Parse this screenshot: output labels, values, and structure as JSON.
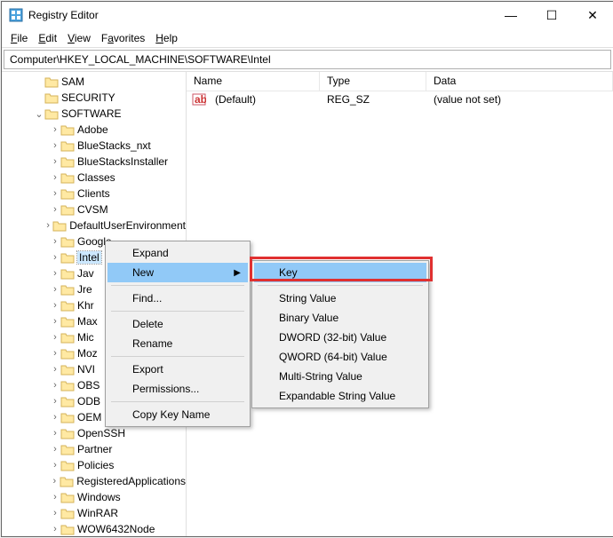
{
  "title": "Registry Editor",
  "menu": {
    "file": "File",
    "edit": "Edit",
    "view": "View",
    "favorites": "Favorites",
    "help": "Help"
  },
  "address": "Computer\\HKEY_LOCAL_MACHINE\\SOFTWARE\\Intel",
  "tree_top": [
    "SAM",
    "SECURITY",
    "SOFTWARE"
  ],
  "software_children": [
    "Adobe",
    "BlueStacks_nxt",
    "BlueStacksInstaller",
    "Classes",
    "Clients",
    "CVSM",
    "DefaultUserEnvironment",
    "Google",
    "Intel",
    "Java",
    "JreMetrics",
    "Khronos",
    "Maximus",
    "Microsoft",
    "Mozilla",
    "NVIDIA",
    "OBS",
    "ODBC",
    "OEM",
    "OpenSSH",
    "Partner",
    "Policies",
    "RegisteredApplications",
    "Windows",
    "WinRAR",
    "WOW6432Node"
  ],
  "list": {
    "headers": {
      "name": "Name",
      "type": "Type",
      "data": "Data"
    },
    "row": {
      "name": "(Default)",
      "type": "REG_SZ",
      "data": "(value not set)"
    }
  },
  "ctx1": {
    "expand": "Expand",
    "new": "New",
    "find": "Find...",
    "delete": "Delete",
    "rename": "Rename",
    "export": "Export",
    "permissions": "Permissions...",
    "copy": "Copy Key Name"
  },
  "ctx2": {
    "key": "Key",
    "string": "String Value",
    "binary": "Binary Value",
    "dword": "DWORD (32-bit) Value",
    "qword": "QWORD (64-bit) Value",
    "multi": "Multi-String Value",
    "expand": "Expandable String Value"
  },
  "controls": {
    "min": "—",
    "max": "☐",
    "close": "✕"
  }
}
